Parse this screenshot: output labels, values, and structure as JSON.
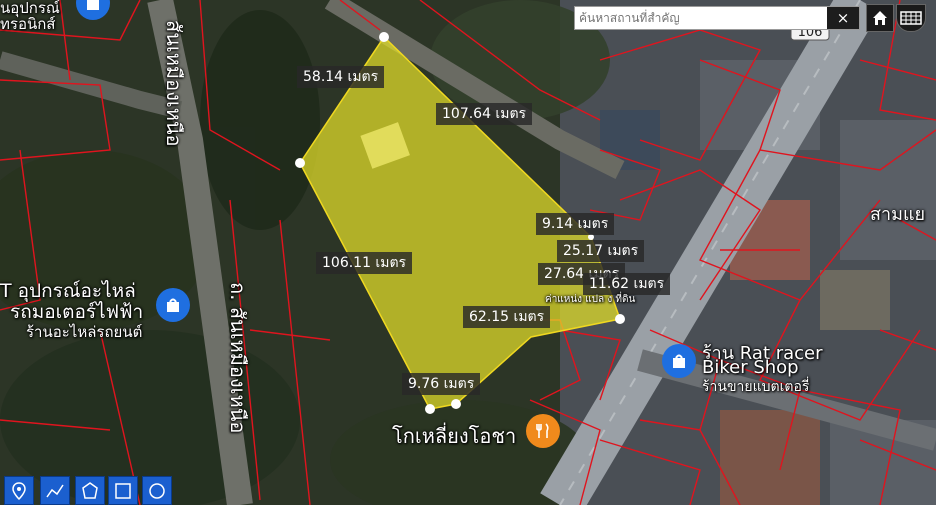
{
  "search": {
    "placeholder": "ค้นหาสถานที่สำคัญ",
    "clear_label": "×"
  },
  "road_sign": "106",
  "dimensions": [
    "58.14 เมตร",
    "107.64 เมตร",
    "9.14 เมตร",
    "25.17 เมตร",
    "27.64 เมตร",
    "11.62 เมตร",
    "106.11 เมตร",
    "62.15 เมตร",
    "9.76 เมตร"
  ],
  "places": {
    "top_left_1": "นอุปกรณ์",
    "top_left_2": "ทรอนิกส์",
    "road_vertical_top": "สันเหมืองเหนือ",
    "road_vertical_bottom": "ถ. สันเหมืองเหนือ",
    "shop_left_1": "T อุปกรณ์อะไหล่",
    "shop_left_2": "รถมอเตอร์ไฟฟ้า",
    "shop_left_3": "ร้านอะไหล่รถยนต์",
    "restaurant": "โกเหลี่ยงโอชา",
    "shop_right_1": "ร้าน Rat racer",
    "shop_right_2": "Biker Shop",
    "shop_right_3": "ร้านขายแบตเตอรี่",
    "small_label": "ค่าแหน่ง แปล ง ที่ดิน",
    "edge_right": "สามแย"
  },
  "colors": {
    "parcel_fill": "#e4e02a",
    "boundary": "#e0141e",
    "pin_blue": "#1f6fe0",
    "pin_orange": "#f08a1c"
  },
  "icons": [
    "home-icon",
    "grid-icon",
    "marker-tool-icon",
    "polyline-tool-icon",
    "polygon-tool-icon",
    "rectangle-tool-icon",
    "circle-tool-icon"
  ]
}
